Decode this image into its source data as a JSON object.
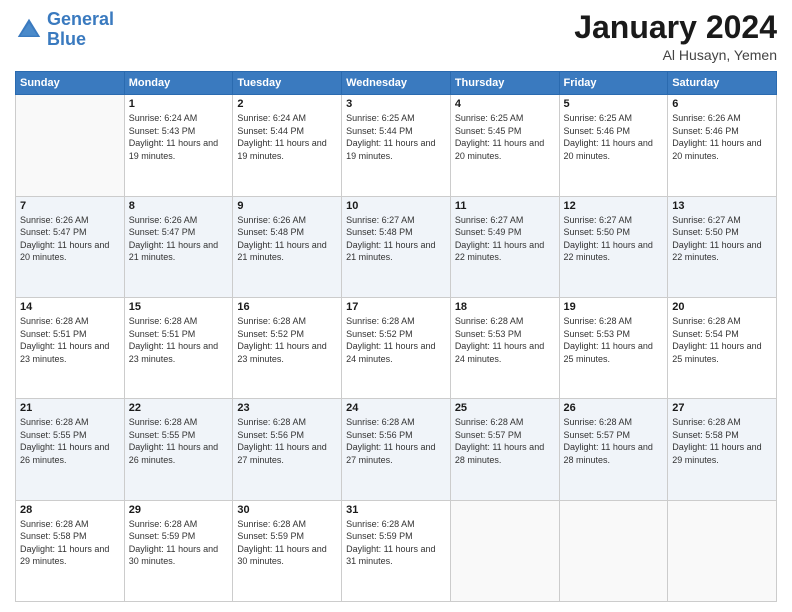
{
  "logo": {
    "line1": "General",
    "line2": "Blue"
  },
  "title": "January 2024",
  "location": "Al Husayn, Yemen",
  "days_of_week": [
    "Sunday",
    "Monday",
    "Tuesday",
    "Wednesday",
    "Thursday",
    "Friday",
    "Saturday"
  ],
  "weeks": [
    [
      {
        "day": "",
        "sunrise": "",
        "sunset": "",
        "daylight": ""
      },
      {
        "day": "1",
        "sunrise": "Sunrise: 6:24 AM",
        "sunset": "Sunset: 5:43 PM",
        "daylight": "Daylight: 11 hours and 19 minutes."
      },
      {
        "day": "2",
        "sunrise": "Sunrise: 6:24 AM",
        "sunset": "Sunset: 5:44 PM",
        "daylight": "Daylight: 11 hours and 19 minutes."
      },
      {
        "day": "3",
        "sunrise": "Sunrise: 6:25 AM",
        "sunset": "Sunset: 5:44 PM",
        "daylight": "Daylight: 11 hours and 19 minutes."
      },
      {
        "day": "4",
        "sunrise": "Sunrise: 6:25 AM",
        "sunset": "Sunset: 5:45 PM",
        "daylight": "Daylight: 11 hours and 20 minutes."
      },
      {
        "day": "5",
        "sunrise": "Sunrise: 6:25 AM",
        "sunset": "Sunset: 5:46 PM",
        "daylight": "Daylight: 11 hours and 20 minutes."
      },
      {
        "day": "6",
        "sunrise": "Sunrise: 6:26 AM",
        "sunset": "Sunset: 5:46 PM",
        "daylight": "Daylight: 11 hours and 20 minutes."
      }
    ],
    [
      {
        "day": "7",
        "sunrise": "Sunrise: 6:26 AM",
        "sunset": "Sunset: 5:47 PM",
        "daylight": "Daylight: 11 hours and 20 minutes."
      },
      {
        "day": "8",
        "sunrise": "Sunrise: 6:26 AM",
        "sunset": "Sunset: 5:47 PM",
        "daylight": "Daylight: 11 hours and 21 minutes."
      },
      {
        "day": "9",
        "sunrise": "Sunrise: 6:26 AM",
        "sunset": "Sunset: 5:48 PM",
        "daylight": "Daylight: 11 hours and 21 minutes."
      },
      {
        "day": "10",
        "sunrise": "Sunrise: 6:27 AM",
        "sunset": "Sunset: 5:48 PM",
        "daylight": "Daylight: 11 hours and 21 minutes."
      },
      {
        "day": "11",
        "sunrise": "Sunrise: 6:27 AM",
        "sunset": "Sunset: 5:49 PM",
        "daylight": "Daylight: 11 hours and 22 minutes."
      },
      {
        "day": "12",
        "sunrise": "Sunrise: 6:27 AM",
        "sunset": "Sunset: 5:50 PM",
        "daylight": "Daylight: 11 hours and 22 minutes."
      },
      {
        "day": "13",
        "sunrise": "Sunrise: 6:27 AM",
        "sunset": "Sunset: 5:50 PM",
        "daylight": "Daylight: 11 hours and 22 minutes."
      }
    ],
    [
      {
        "day": "14",
        "sunrise": "Sunrise: 6:28 AM",
        "sunset": "Sunset: 5:51 PM",
        "daylight": "Daylight: 11 hours and 23 minutes."
      },
      {
        "day": "15",
        "sunrise": "Sunrise: 6:28 AM",
        "sunset": "Sunset: 5:51 PM",
        "daylight": "Daylight: 11 hours and 23 minutes."
      },
      {
        "day": "16",
        "sunrise": "Sunrise: 6:28 AM",
        "sunset": "Sunset: 5:52 PM",
        "daylight": "Daylight: 11 hours and 23 minutes."
      },
      {
        "day": "17",
        "sunrise": "Sunrise: 6:28 AM",
        "sunset": "Sunset: 5:52 PM",
        "daylight": "Daylight: 11 hours and 24 minutes."
      },
      {
        "day": "18",
        "sunrise": "Sunrise: 6:28 AM",
        "sunset": "Sunset: 5:53 PM",
        "daylight": "Daylight: 11 hours and 24 minutes."
      },
      {
        "day": "19",
        "sunrise": "Sunrise: 6:28 AM",
        "sunset": "Sunset: 5:53 PM",
        "daylight": "Daylight: 11 hours and 25 minutes."
      },
      {
        "day": "20",
        "sunrise": "Sunrise: 6:28 AM",
        "sunset": "Sunset: 5:54 PM",
        "daylight": "Daylight: 11 hours and 25 minutes."
      }
    ],
    [
      {
        "day": "21",
        "sunrise": "Sunrise: 6:28 AM",
        "sunset": "Sunset: 5:55 PM",
        "daylight": "Daylight: 11 hours and 26 minutes."
      },
      {
        "day": "22",
        "sunrise": "Sunrise: 6:28 AM",
        "sunset": "Sunset: 5:55 PM",
        "daylight": "Daylight: 11 hours and 26 minutes."
      },
      {
        "day": "23",
        "sunrise": "Sunrise: 6:28 AM",
        "sunset": "Sunset: 5:56 PM",
        "daylight": "Daylight: 11 hours and 27 minutes."
      },
      {
        "day": "24",
        "sunrise": "Sunrise: 6:28 AM",
        "sunset": "Sunset: 5:56 PM",
        "daylight": "Daylight: 11 hours and 27 minutes."
      },
      {
        "day": "25",
        "sunrise": "Sunrise: 6:28 AM",
        "sunset": "Sunset: 5:57 PM",
        "daylight": "Daylight: 11 hours and 28 minutes."
      },
      {
        "day": "26",
        "sunrise": "Sunrise: 6:28 AM",
        "sunset": "Sunset: 5:57 PM",
        "daylight": "Daylight: 11 hours and 28 minutes."
      },
      {
        "day": "27",
        "sunrise": "Sunrise: 6:28 AM",
        "sunset": "Sunset: 5:58 PM",
        "daylight": "Daylight: 11 hours and 29 minutes."
      }
    ],
    [
      {
        "day": "28",
        "sunrise": "Sunrise: 6:28 AM",
        "sunset": "Sunset: 5:58 PM",
        "daylight": "Daylight: 11 hours and 29 minutes."
      },
      {
        "day": "29",
        "sunrise": "Sunrise: 6:28 AM",
        "sunset": "Sunset: 5:59 PM",
        "daylight": "Daylight: 11 hours and 30 minutes."
      },
      {
        "day": "30",
        "sunrise": "Sunrise: 6:28 AM",
        "sunset": "Sunset: 5:59 PM",
        "daylight": "Daylight: 11 hours and 30 minutes."
      },
      {
        "day": "31",
        "sunrise": "Sunrise: 6:28 AM",
        "sunset": "Sunset: 5:59 PM",
        "daylight": "Daylight: 11 hours and 31 minutes."
      },
      {
        "day": "",
        "sunrise": "",
        "sunset": "",
        "daylight": ""
      },
      {
        "day": "",
        "sunrise": "",
        "sunset": "",
        "daylight": ""
      },
      {
        "day": "",
        "sunrise": "",
        "sunset": "",
        "daylight": ""
      }
    ]
  ]
}
